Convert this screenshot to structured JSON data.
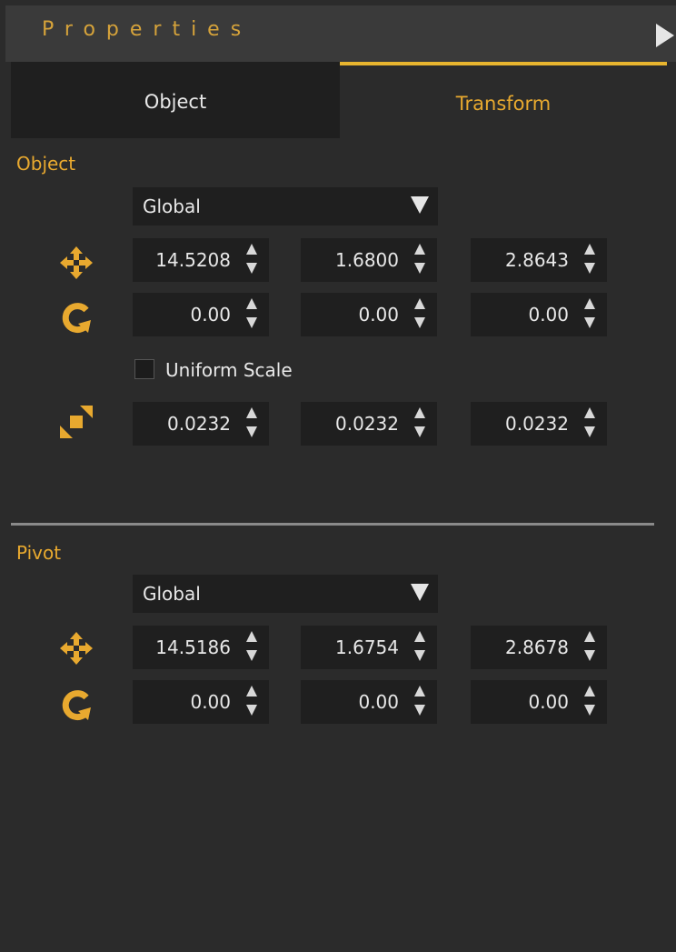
{
  "panel": {
    "title": "Properties"
  },
  "tabs": [
    {
      "label": "Object",
      "active": false
    },
    {
      "label": "Transform",
      "active": true
    }
  ],
  "object": {
    "label": "Object",
    "space": "Global",
    "position": [
      "14.5208",
      "1.6800",
      "2.8643"
    ],
    "rotation": [
      "0.00",
      "0.00",
      "0.00"
    ],
    "uniform_scale": {
      "label": "Uniform Scale",
      "checked": false
    },
    "scale": [
      "0.0232",
      "0.0232",
      "0.0232"
    ]
  },
  "pivot": {
    "label": "Pivot",
    "space": "Global",
    "position": [
      "14.5186",
      "1.6754",
      "2.8678"
    ],
    "rotation": [
      "0.00",
      "0.00",
      "0.00"
    ]
  },
  "colors": {
    "accent": "#e8a92f",
    "background": "#2b2b2b",
    "field": "#1f1f1f"
  },
  "icons": [
    "move-icon",
    "rotate-icon",
    "scale-icon",
    "dropdown-arrow-icon",
    "collapse-arrow-icon"
  ]
}
